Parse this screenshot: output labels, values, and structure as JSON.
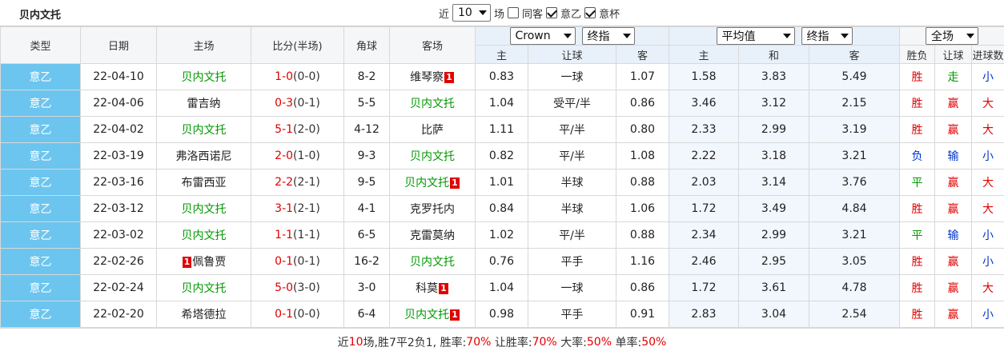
{
  "header": {
    "team": "贝内文托",
    "near_label": "近",
    "near_value": "10",
    "games_label": "场",
    "same_home_label": "同客",
    "same_home_checked": false,
    "league_label": "意乙",
    "league_checked": true,
    "cup_label": "意杯",
    "cup_checked": true
  },
  "columns": {
    "type": "类型",
    "date": "日期",
    "home": "主场",
    "score": "比分(半场)",
    "corner": "角球",
    "away": "客场",
    "odds_company": "Crown",
    "odds_kind": "终指",
    "avg_kind": "平均值",
    "avg_type": "终指",
    "all_field": "全场",
    "ah_home": "主",
    "ah_line": "让球",
    "ah_away": "客",
    "eu_home": "主",
    "eu_draw": "和",
    "eu_away": "客",
    "wl": "胜负",
    "handicap": "让球",
    "goals": "进球数"
  },
  "rows": [
    {
      "type": "意乙",
      "date": "22-04-10",
      "home": "贝内文托",
      "home_green": true,
      "home_card": "",
      "score_ft": "1-0",
      "score_ht": "(0-0)",
      "corner": "8-2",
      "away": "维琴察",
      "away_green": false,
      "away_card": "1",
      "ah_home": "0.83",
      "ah_line": "一球",
      "ah_away": "1.07",
      "eu_home": "1.58",
      "eu_draw": "3.83",
      "eu_away": "5.49",
      "wl": "胜",
      "wl_color": "red",
      "hc": "走",
      "hc_color": "grn",
      "ou": "小",
      "ou_color": "blue"
    },
    {
      "type": "意乙",
      "date": "22-04-06",
      "home": "雷吉纳",
      "home_green": false,
      "home_card": "",
      "score_ft": "0-3",
      "score_ht": "(0-1)",
      "corner": "5-5",
      "away": "贝内文托",
      "away_green": true,
      "away_card": "",
      "ah_home": "1.04",
      "ah_line": "受平/半",
      "ah_away": "0.86",
      "eu_home": "3.46",
      "eu_draw": "3.12",
      "eu_away": "2.15",
      "wl": "胜",
      "wl_color": "red",
      "hc": "赢",
      "hc_color": "red",
      "ou": "大",
      "ou_color": "red"
    },
    {
      "type": "意乙",
      "date": "22-04-02",
      "home": "贝内文托",
      "home_green": true,
      "home_card": "",
      "score_ft": "5-1",
      "score_ht": "(2-0)",
      "corner": "4-12",
      "away": "比萨",
      "away_green": false,
      "away_card": "",
      "ah_home": "1.11",
      "ah_line": "平/半",
      "ah_away": "0.80",
      "eu_home": "2.33",
      "eu_draw": "2.99",
      "eu_away": "3.19",
      "wl": "胜",
      "wl_color": "red",
      "hc": "赢",
      "hc_color": "red",
      "ou": "大",
      "ou_color": "red"
    },
    {
      "type": "意乙",
      "date": "22-03-19",
      "home": "弗洛西诺尼",
      "home_green": false,
      "home_card": "",
      "score_ft": "2-0",
      "score_ht": "(1-0)",
      "corner": "9-3",
      "away": "贝内文托",
      "away_green": true,
      "away_card": "",
      "ah_home": "0.82",
      "ah_line": "平/半",
      "ah_away": "1.08",
      "eu_home": "2.22",
      "eu_draw": "3.18",
      "eu_away": "3.21",
      "wl": "负",
      "wl_color": "blue",
      "hc": "输",
      "hc_color": "blue",
      "ou": "小",
      "ou_color": "blue"
    },
    {
      "type": "意乙",
      "date": "22-03-16",
      "home": "布雷西亚",
      "home_green": false,
      "home_card": "",
      "score_ft": "2-2",
      "score_ht": "(2-1)",
      "corner": "9-5",
      "away": "贝内文托",
      "away_green": true,
      "away_card": "1",
      "ah_home": "1.01",
      "ah_line": "半球",
      "ah_away": "0.88",
      "eu_home": "2.03",
      "eu_draw": "3.14",
      "eu_away": "3.76",
      "wl": "平",
      "wl_color": "grn",
      "hc": "赢",
      "hc_color": "red",
      "ou": "大",
      "ou_color": "red"
    },
    {
      "type": "意乙",
      "date": "22-03-12",
      "home": "贝内文托",
      "home_green": true,
      "home_card": "",
      "score_ft": "3-1",
      "score_ht": "(2-1)",
      "corner": "4-1",
      "away": "克罗托内",
      "away_green": false,
      "away_card": "",
      "ah_home": "0.84",
      "ah_line": "半球",
      "ah_away": "1.06",
      "eu_home": "1.72",
      "eu_draw": "3.49",
      "eu_away": "4.84",
      "wl": "胜",
      "wl_color": "red",
      "hc": "赢",
      "hc_color": "red",
      "ou": "大",
      "ou_color": "red"
    },
    {
      "type": "意乙",
      "date": "22-03-02",
      "home": "贝内文托",
      "home_green": true,
      "home_card": "",
      "score_ft": "1-1",
      "score_ht": "(1-1)",
      "corner": "6-5",
      "away": "克雷莫纳",
      "away_green": false,
      "away_card": "",
      "ah_home": "1.02",
      "ah_line": "平/半",
      "ah_away": "0.88",
      "eu_home": "2.34",
      "eu_draw": "2.99",
      "eu_away": "3.21",
      "wl": "平",
      "wl_color": "grn",
      "hc": "输",
      "hc_color": "blue",
      "ou": "小",
      "ou_color": "blue"
    },
    {
      "type": "意乙",
      "date": "22-02-26",
      "home": "佩鲁贾",
      "home_green": false,
      "home_card": "1",
      "score_ft": "0-1",
      "score_ht": "(0-1)",
      "corner": "16-2",
      "away": "贝内文托",
      "away_green": true,
      "away_card": "",
      "ah_home": "0.76",
      "ah_line": "平手",
      "ah_away": "1.16",
      "eu_home": "2.46",
      "eu_draw": "2.95",
      "eu_away": "3.05",
      "wl": "胜",
      "wl_color": "red",
      "hc": "赢",
      "hc_color": "red",
      "ou": "小",
      "ou_color": "blue"
    },
    {
      "type": "意乙",
      "date": "22-02-24",
      "home": "贝内文托",
      "home_green": true,
      "home_card": "",
      "score_ft": "5-0",
      "score_ht": "(3-0)",
      "corner": "3-0",
      "away": "科莫",
      "away_green": false,
      "away_card": "1",
      "ah_home": "1.04",
      "ah_line": "一球",
      "ah_away": "0.86",
      "eu_home": "1.72",
      "eu_draw": "3.61",
      "eu_away": "4.78",
      "wl": "胜",
      "wl_color": "red",
      "hc": "赢",
      "hc_color": "red",
      "ou": "大",
      "ou_color": "red"
    },
    {
      "type": "意乙",
      "date": "22-02-20",
      "home": "希塔德拉",
      "home_green": false,
      "home_card": "",
      "score_ft": "0-1",
      "score_ht": "(0-0)",
      "corner": "6-4",
      "away": "贝内文托",
      "away_green": true,
      "away_card": "1",
      "ah_home": "0.98",
      "ah_line": "平手",
      "ah_away": "0.91",
      "eu_home": "2.83",
      "eu_draw": "3.04",
      "eu_away": "2.54",
      "wl": "胜",
      "wl_color": "red",
      "hc": "赢",
      "hc_color": "red",
      "ou": "小",
      "ou_color": "blue"
    }
  ],
  "summary": {
    "p1": "近",
    "n": "10",
    "p2": "场,胜7平2负1, 胜率:",
    "win_rate": "70%",
    "p3": " 让胜率:",
    "hc_rate": "70%",
    "p4": " 大率:",
    "big_rate": "50%",
    "p5": " 单率:",
    "odd_rate": "50%"
  },
  "colors": {
    "type_bg": "#6cc5ee",
    "green": "#009900",
    "red": "#e00000",
    "blue": "#0033cc"
  }
}
